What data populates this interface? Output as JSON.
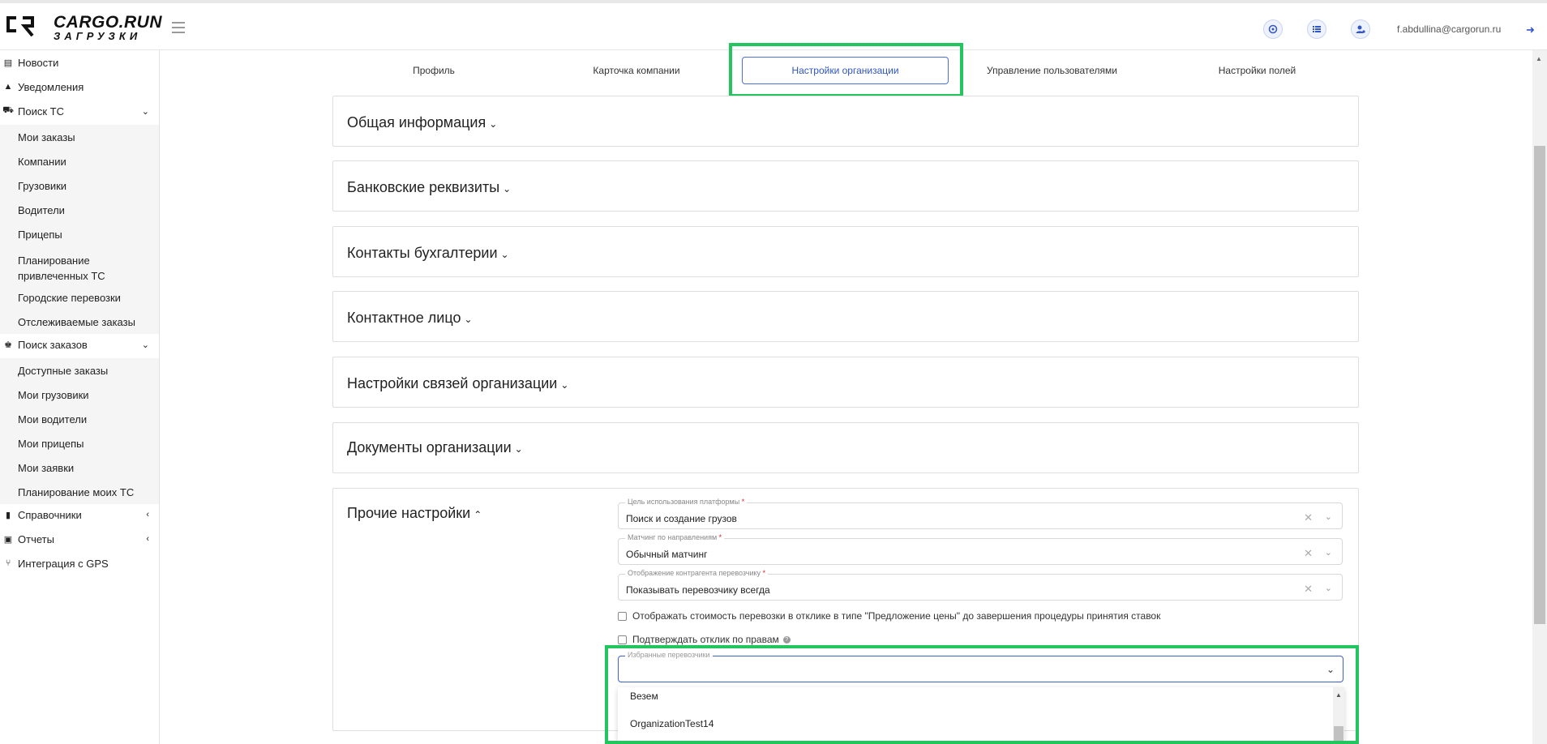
{
  "brand": {
    "name": "CARGO.RUN",
    "sub": "ЗАГРУЗКИ"
  },
  "header": {
    "user_email": "f.abdullina@cargorun.ru"
  },
  "sidebar": {
    "items": [
      {
        "label": "Новости",
        "icon": "news-icon"
      },
      {
        "label": "Уведомления",
        "icon": "bell-icon"
      },
      {
        "label": "Поиск ТС",
        "icon": "truck-icon",
        "expanded": true
      },
      {
        "label": "Поиск заказов",
        "icon": "scale-icon",
        "expanded": true
      },
      {
        "label": "Справочники",
        "icon": "book-icon"
      },
      {
        "label": "Отчеты",
        "icon": "report-icon"
      },
      {
        "label": "Интеграция с GPS",
        "icon": "gps-icon"
      }
    ],
    "search_ts_sub": [
      "Мои заказы",
      "Компании",
      "Грузовики",
      "Водители",
      "Прицепы",
      "Планирование привлеченных ТС",
      "Городские перевозки",
      "Отслеживаемые заказы"
    ],
    "search_orders_sub": [
      "Доступные заказы",
      "Мои грузовики",
      "Мои водители",
      "Мои прицепы",
      "Мои заявки",
      "Планирование моих ТС"
    ]
  },
  "tabs": [
    "Профиль",
    "Карточка компании",
    "Настройки организации",
    "Управление пользователями",
    "Настройки полей"
  ],
  "active_tab": "Настройки организации",
  "panels": [
    "Общая информация",
    "Банковские реквизиты",
    "Контакты бухгалтерии",
    "Контактное лицо",
    "Настройки связей организации",
    "Документы организации",
    "Прочие настройки"
  ],
  "other_settings": {
    "fields": [
      {
        "legend": "Цель использования платформы",
        "value": "Поиск и создание грузов"
      },
      {
        "legend": "Матчинг по направлениям",
        "value": "Обычный матчинг"
      },
      {
        "legend": "Отображение контрагента перевозчику",
        "value": "Показывать перевозчику всегда"
      }
    ],
    "checkbox1": "Отображать стоимость перевозки в отклике в типе \"Предложение цены\" до завершения процедуры принятия ставок",
    "checkbox2": "Подтверждать отклик по правам",
    "favorites_legend": "Избранные перевозчики",
    "favorites_options": [
      "Везем",
      "OrganizationTest14"
    ]
  },
  "colors": {
    "accent": "#2f54c4",
    "highlight": "#22c55e",
    "required": "#e02424"
  }
}
